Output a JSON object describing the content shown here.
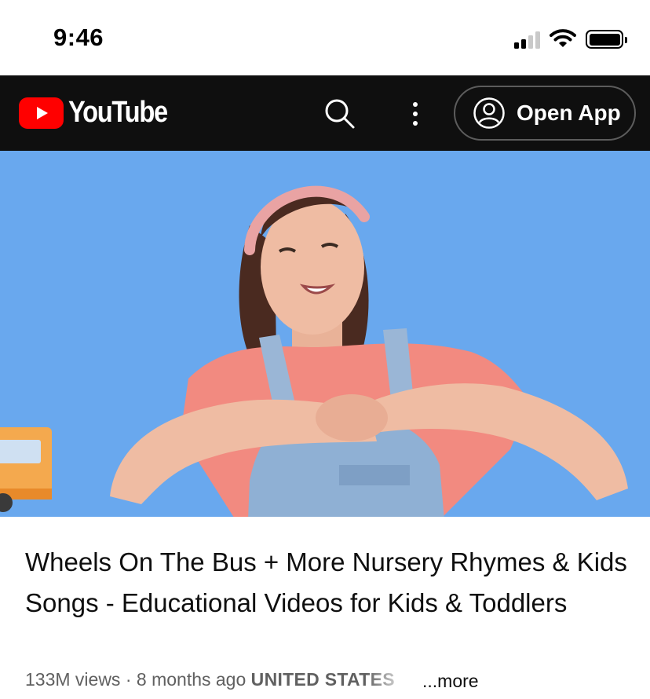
{
  "status_bar": {
    "time": "9:46"
  },
  "header": {
    "logo_text": "YouTube",
    "open_app_label": "Open App",
    "colors": {
      "background": "#0f0f0f",
      "brand_red": "#ff0000"
    }
  },
  "video": {
    "title": "Wheels On The Bus + More Nursery Rhymes & Kids Songs - Educational Videos for Kids & Toddlers",
    "views": "133M views",
    "separator": "·",
    "age": "8 months ago",
    "country": "UNITED STATES",
    "more_label": "...more",
    "colors": {
      "backdrop": "#69a8ee",
      "shirt": "#f28a80",
      "overalls": "#9ab6d6"
    }
  },
  "icons": [
    "signal-icon",
    "wifi-icon",
    "battery-icon",
    "youtube-logo-icon",
    "search-icon",
    "more-vert-icon",
    "account-circle-icon"
  ]
}
